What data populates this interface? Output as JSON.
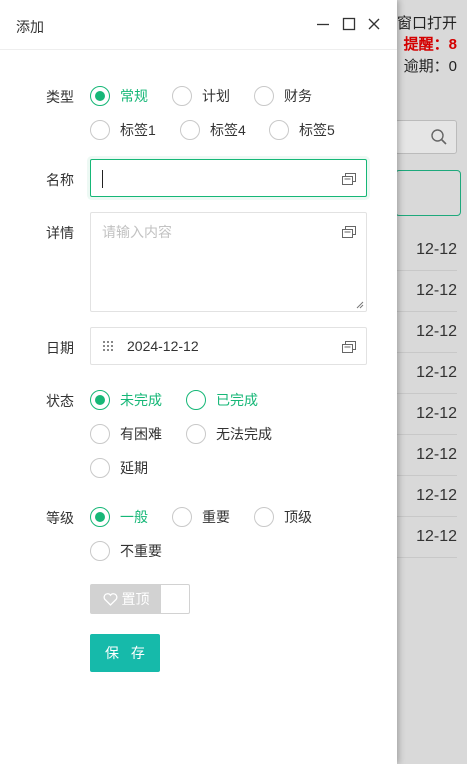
{
  "background": {
    "window_open_text": "窗口打开",
    "alert_text": "提醒：8",
    "overdue_text": "逾期：0",
    "search_icon": "search-icon",
    "rows": [
      "12-12",
      "12-12",
      "12-12",
      "12-12",
      "12-12",
      "12-12",
      "12-12",
      "12-12"
    ]
  },
  "dialog": {
    "title": "添加",
    "controls": [
      "minimize-icon",
      "maximize-icon",
      "close-icon"
    ]
  },
  "form": {
    "type": {
      "label": "类型",
      "options": [
        "常规",
        "计划",
        "财务",
        "标签1",
        "标签4",
        "标签5"
      ],
      "selected": "常规"
    },
    "name": {
      "label": "名称",
      "value": ""
    },
    "details": {
      "label": "详情",
      "placeholder": "请输入内容"
    },
    "date": {
      "label": "日期",
      "value": "2024-12-12"
    },
    "status": {
      "label": "状态",
      "options": [
        "未完成",
        "已完成",
        "有困难",
        "无法完成",
        "延期"
      ],
      "selected": "未完成"
    },
    "level": {
      "label": "等级",
      "options": [
        "一般",
        "重要",
        "顶级",
        "不重要"
      ],
      "selected": "一般"
    },
    "pin": {
      "label": "置顶",
      "on": false
    },
    "save": "保 存"
  },
  "colors": {
    "accent": "#16b777",
    "button": "#16baaa",
    "alert": "#d40000"
  }
}
